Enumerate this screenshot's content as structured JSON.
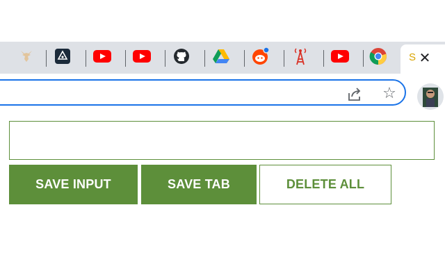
{
  "browser": {
    "tabs": [
      {
        "icon": "deer-icon",
        "color": "#e8c9a0"
      },
      {
        "icon": "hacker-rank-icon",
        "color": "#1e2a3a"
      },
      {
        "icon": "youtube-icon",
        "color": "#ff0000"
      },
      {
        "icon": "youtube-icon",
        "color": "#ff0000"
      },
      {
        "icon": "github-icon",
        "color": "#24292e"
      },
      {
        "icon": "google-drive-icon",
        "color": "#1fa463"
      },
      {
        "icon": "reddit-icon",
        "color": "#ff4500"
      },
      {
        "icon": "radio-tower-icon",
        "color": "#d93025"
      },
      {
        "icon": "youtube-icon",
        "color": "#ff0000"
      },
      {
        "icon": "chrome-icon",
        "color": "#4285f4"
      }
    ],
    "active_tab": {
      "title_fragment": "S",
      "close_label": "✕"
    },
    "omnibox": {
      "accent": "#1a73e8"
    },
    "star_label": "☆"
  },
  "extension": {
    "input": {
      "value": "",
      "placeholder": ""
    },
    "buttons": {
      "save_input": "SAVE INPUT",
      "save_tab": "SAVE TAB",
      "delete_all": "DELETE ALL"
    },
    "accent_color": "#5d8f3a"
  }
}
